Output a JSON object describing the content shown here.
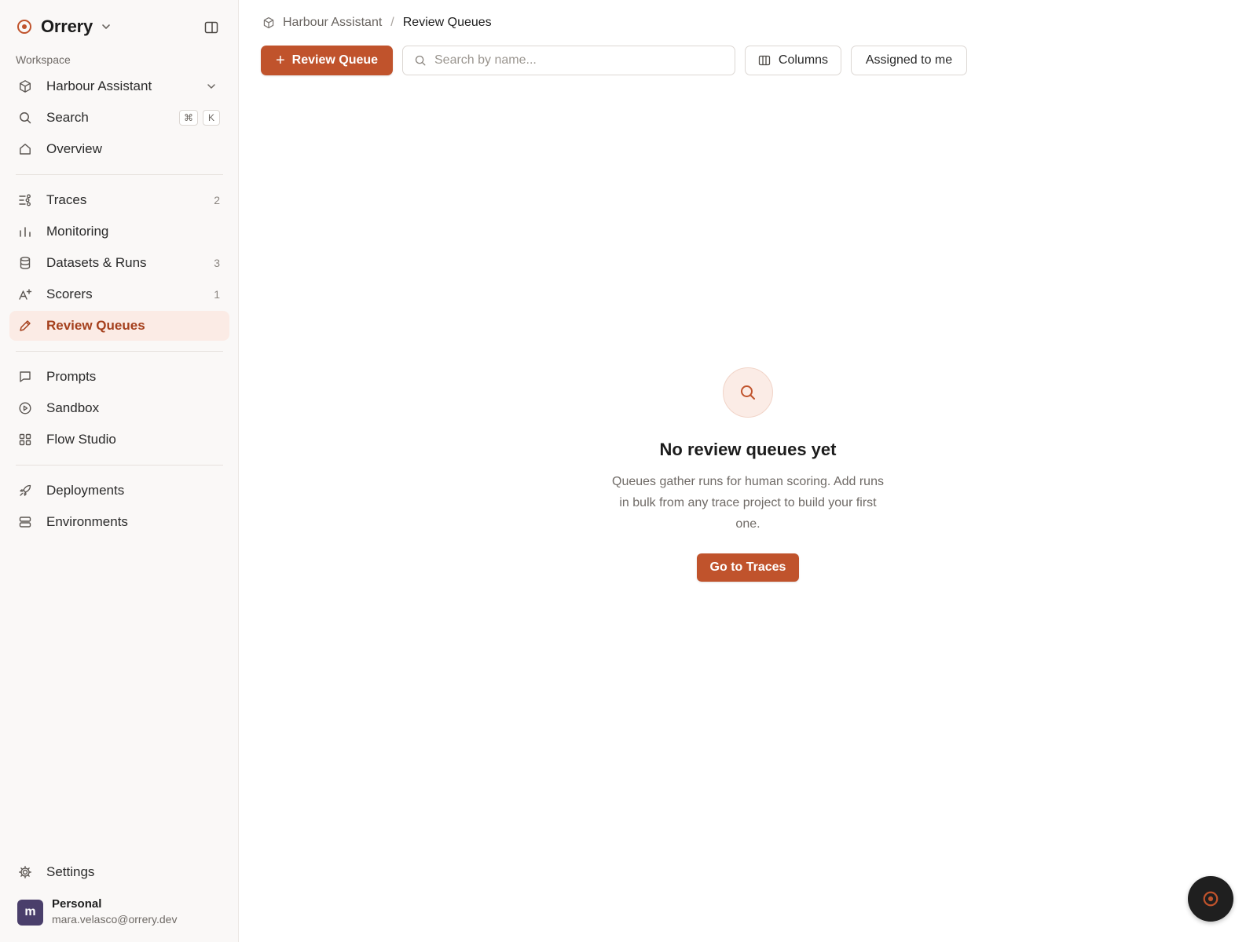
{
  "app": {
    "name": "Orrery",
    "accent_color": "#c0532c"
  },
  "sidebar": {
    "section_label": "Workspace",
    "workspace": {
      "label": "Harbour Assistant",
      "icon": "cube-icon"
    },
    "search": {
      "label": "Search",
      "shortcut_keys": [
        "⌘",
        "K"
      ]
    },
    "overview": {
      "label": "Overview"
    },
    "group_observe": [
      {
        "label": "Traces",
        "count": "2",
        "icon": "traces-icon"
      },
      {
        "label": "Monitoring",
        "count": "",
        "icon": "bar-chart-icon"
      },
      {
        "label": "Datasets & Runs",
        "count": "3",
        "icon": "database-icon"
      },
      {
        "label": "Scorers",
        "count": "1",
        "icon": "scorers-icon"
      },
      {
        "label": "Review Queues",
        "count": "",
        "icon": "pencil-icon",
        "active": true
      }
    ],
    "group_build": [
      {
        "label": "Prompts",
        "icon": "chat-bubble-icon"
      },
      {
        "label": "Sandbox",
        "icon": "play-circle-icon"
      },
      {
        "label": "Flow Studio",
        "icon": "grid-icon"
      }
    ],
    "group_deploy": [
      {
        "label": "Deployments",
        "icon": "rocket-icon"
      },
      {
        "label": "Environments",
        "icon": "server-icon"
      }
    ],
    "settings": {
      "label": "Settings"
    },
    "user": {
      "initial": "m",
      "name": "Personal",
      "email": "mara.velasco@orrery.dev"
    }
  },
  "breadcrumb": {
    "parent": "Harbour Assistant",
    "separator": "/",
    "current": "Review Queues"
  },
  "toolbar": {
    "new_button_label": "Review Queue",
    "search_placeholder": "Search by name...",
    "columns_label": "Columns",
    "assigned_label": "Assigned to me"
  },
  "empty_state": {
    "title": "No review queues yet",
    "description": "Queues gather runs for human scoring. Add runs in bulk from any trace project to build your first one.",
    "cta_label": "Go to Traces"
  }
}
